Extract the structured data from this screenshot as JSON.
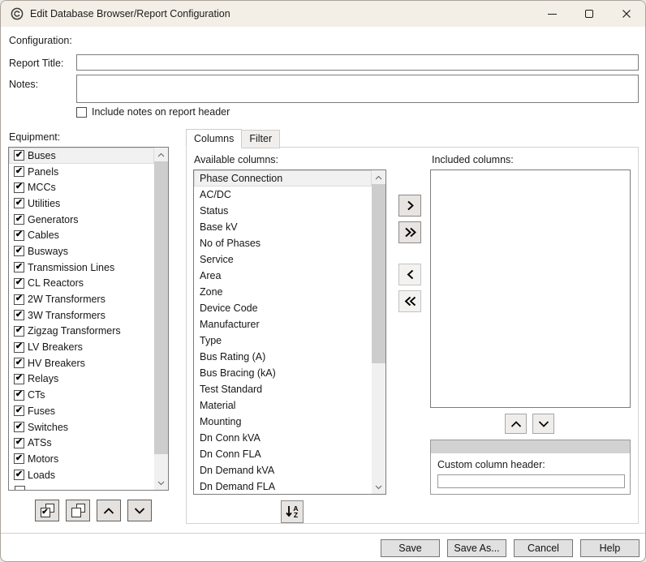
{
  "window": {
    "title": "Edit Database Browser/Report Configuration"
  },
  "config": {
    "configuration_label": "Configuration:",
    "report_title_label": "Report Title:",
    "report_title_value": "",
    "notes_label": "Notes:",
    "notes_value": "",
    "include_notes_label": "Include notes on report header",
    "include_notes_checked": false
  },
  "equipment": {
    "label": "Equipment:",
    "selected_index": 0,
    "items": [
      {
        "label": "Buses",
        "checked": true
      },
      {
        "label": "Panels",
        "checked": true
      },
      {
        "label": "MCCs",
        "checked": true
      },
      {
        "label": "Utilities",
        "checked": true
      },
      {
        "label": "Generators",
        "checked": true
      },
      {
        "label": "Cables",
        "checked": true
      },
      {
        "label": "Busways",
        "checked": true
      },
      {
        "label": "Transmission Lines",
        "checked": true
      },
      {
        "label": "CL Reactors",
        "checked": true
      },
      {
        "label": "2W Transformers",
        "checked": true
      },
      {
        "label": "3W Transformers",
        "checked": true
      },
      {
        "label": "Zigzag Transformers",
        "checked": true
      },
      {
        "label": "LV Breakers",
        "checked": true
      },
      {
        "label": "HV Breakers",
        "checked": true
      },
      {
        "label": "Relays",
        "checked": true
      },
      {
        "label": "CTs",
        "checked": true
      },
      {
        "label": "Fuses",
        "checked": true
      },
      {
        "label": "Switches",
        "checked": true
      },
      {
        "label": "ATSs",
        "checked": true
      },
      {
        "label": "Motors",
        "checked": true
      },
      {
        "label": "Loads",
        "checked": true
      }
    ]
  },
  "tabs": [
    {
      "label": "Columns",
      "active": true
    },
    {
      "label": "Filter",
      "active": false
    }
  ],
  "columns_tab": {
    "available_label": "Available columns:",
    "available_selected_index": 0,
    "available_items": [
      "Phase Connection",
      "AC/DC",
      "Status",
      "Base kV",
      "No of Phases",
      "Service",
      "Area",
      "Zone",
      "Device Code",
      "Manufacturer",
      "Type",
      "Bus Rating (A)",
      "Bus Bracing (kA)",
      "Test Standard",
      "Material",
      "Mounting",
      "Dn Conn kVA",
      "Dn Conn FLA",
      "Dn Demand kVA",
      "Dn Demand FLA"
    ],
    "included_label": "Included columns:",
    "included_items": [],
    "custom_header_label": "Custom column header:",
    "custom_header_value": ""
  },
  "icons": {
    "app": "circled-logo",
    "minimize": "line",
    "maximize": "square-outline",
    "close": "x",
    "check": "✔",
    "sort_a": "A",
    "sort_z": "Z",
    "add": "chevron-right",
    "add_all": "double-chevron-right",
    "remove": "chevron-left",
    "remove_all": "double-chevron-left",
    "move_up": "chevron-up",
    "move_down": "chevron-down",
    "check_all": "overlapping-squares-checked",
    "uncheck_all": "overlapping-squares-empty"
  },
  "footer": {
    "save": "Save",
    "save_as": "Save As...",
    "cancel": "Cancel",
    "help": "Help"
  }
}
